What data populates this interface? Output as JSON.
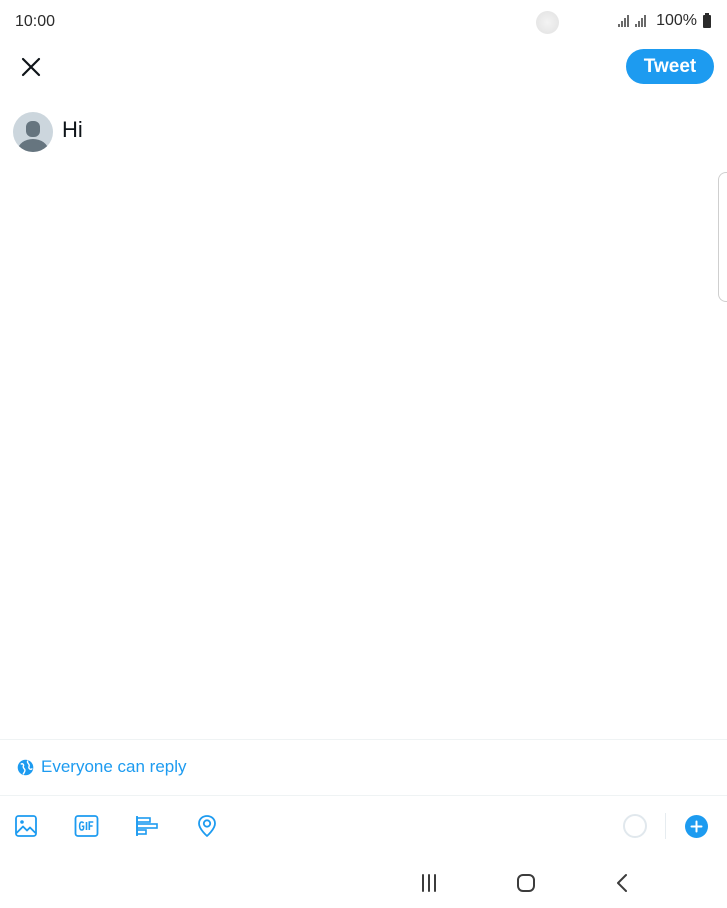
{
  "status_bar": {
    "time": "10:00",
    "battery": "100%"
  },
  "header": {
    "close_icon": "close-icon",
    "tweet_label": "Tweet"
  },
  "compose": {
    "text": "Hi",
    "avatar_icon": "default-avatar-icon"
  },
  "reply_setting": {
    "icon": "globe-icon",
    "label": "Everyone can reply"
  },
  "toolbar": {
    "items": [
      "image-icon",
      "gif-icon",
      "poll-icon",
      "location-icon"
    ],
    "add_icon": "plus-icon"
  },
  "navigation": {
    "items": [
      "recents-icon",
      "home-icon",
      "back-icon"
    ]
  },
  "colors": {
    "accent": "#1d9bf0",
    "text": "#0f1419",
    "divider": "#eff3f4"
  }
}
